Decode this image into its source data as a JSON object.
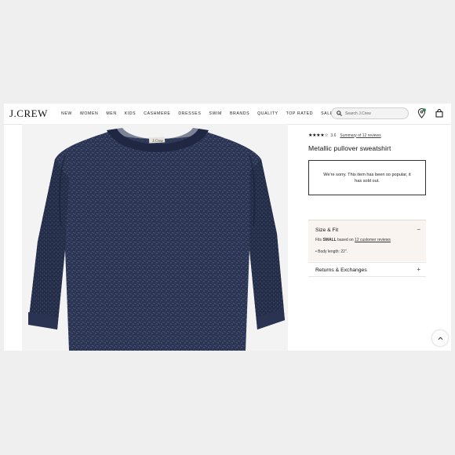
{
  "header": {
    "logo": "J.CREW",
    "nav": [
      "NEW",
      "WOMEN",
      "MEN",
      "KIDS",
      "CASHMERE",
      "DRESSES",
      "SWIM",
      "BRANDS",
      "QUALITY",
      "TOP RATED",
      "SALE"
    ],
    "search_placeholder": "Search J.Crew"
  },
  "product": {
    "stars": "★★★★☆",
    "rating": "3.6",
    "reviews_link": "Summary of 12 reviews",
    "title": "Metallic pullover sweatshirt",
    "sold_out_message": "We're sorry. This item has been so popular, it has sold out."
  },
  "size_fit": {
    "title": "Size & Fit",
    "toggle": "−",
    "fits_prefix": "Fits",
    "fits_size": "SMALL",
    "fits_middle": "based on",
    "fits_link": "12 customer reviews",
    "bullet": "•  Body length: 22\"."
  },
  "returns": {
    "title": "Returns & Exchanges",
    "toggle": "+"
  },
  "colors": {
    "sweater": "#2a3450",
    "accent_green": "#2e7d4f"
  }
}
